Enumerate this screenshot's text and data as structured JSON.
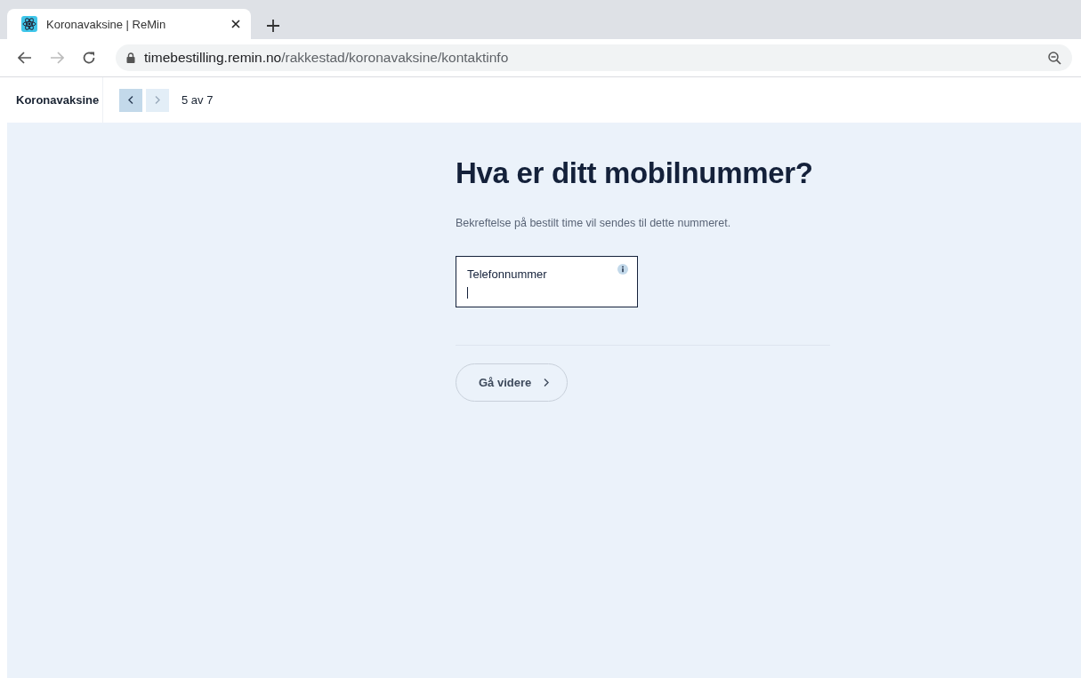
{
  "browser": {
    "tab": {
      "title": "Koronavaksine | ReMin",
      "selected": true
    },
    "url_host": "timebestilling.remin.no",
    "url_path": "/rakkestad/koronavaksine/kontaktinfo"
  },
  "header": {
    "title": "Koronavaksine",
    "prev": {
      "disabled": false
    },
    "next": {
      "disabled": true
    },
    "step": "5 av 7"
  },
  "form": {
    "heading": "Hva er ditt mobilnummer?",
    "description": "Bekreftelse på bestilt time vil sendes til dette nummeret.",
    "field": {
      "label": "Telefonnummer",
      "focused": true
    },
    "button": "Gå videre"
  }
}
